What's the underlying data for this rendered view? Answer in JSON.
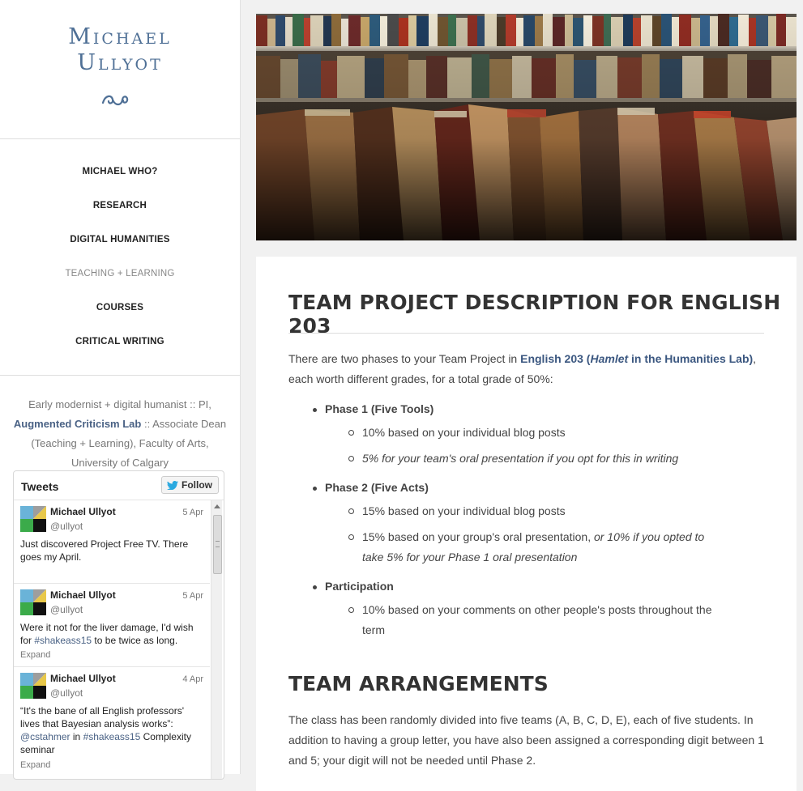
{
  "site": {
    "title_line1": "Michael",
    "title_line2": "Ullyot"
  },
  "nav": {
    "items": [
      "MICHAEL WHO?",
      "RESEARCH",
      "DIGITAL HUMANITIES",
      "TEACHING + LEARNING",
      "COURSES",
      "CRITICAL WRITING"
    ]
  },
  "bio": {
    "pre": "Early modernist + digital humanist :: PI,",
    "lab": "Augmented Criticism Lab",
    "post": ":: Associate Dean (Teaching + Learning), Faculty of Arts, University of Calgary"
  },
  "tweets": {
    "header": "Tweets",
    "follow_label": "Follow",
    "items": [
      {
        "name": "Michael Ullyot",
        "handle": "@ullyot",
        "date": "5 Apr",
        "text": "Just discovered Project Free TV. There goes my April."
      },
      {
        "name": "Michael Ullyot",
        "handle": "@ullyot",
        "date": "5 Apr",
        "text_pre": "Were it not for the liver damage, I'd wish for",
        "tag": "#shakeass15",
        "text_post": "to be twice as long.",
        "expand": "Expand"
      },
      {
        "name": "Michael Ullyot",
        "handle": "@ullyot",
        "date": "4 Apr",
        "text_pre": "“It's the bane of all English professors' lives that Bayesian analysis works”:",
        "mention": "@cstahmer",
        "text_in": "in",
        "tag": "#shakeass15",
        "text_post": "Complexity seminar",
        "expand": "Expand"
      }
    ]
  },
  "article": {
    "title": "TEAM PROJECT DESCRIPTION FOR ENGLISH 203",
    "intro_pre": "There are two phases to your Team Project in",
    "course_link_pre": "English 203 (",
    "course_link_em": "Hamlet",
    "course_link_post": " in the Humanities Lab)",
    "intro_post": ", each worth different grades, for a total grade of 50%:",
    "phases": [
      {
        "label": "Phase 1 (Five Tools)",
        "items": [
          "10% based on your individual blog posts",
          "5% for your team's oral presentation if you opt for this in writing"
        ]
      },
      {
        "label": "Phase 2 (Five Acts)",
        "items": [
          "15% based on your individual blog posts",
          "15% based on your group's oral presentation,",
          "or 10% if you opted to",
          "take 5% for your Phase 1 oral presentation"
        ]
      },
      {
        "label": "Participation",
        "items": [
          "10% based on your comments on other people's posts throughout the",
          "term"
        ]
      }
    ],
    "section2_title": "TEAM ARRANGEMENTS",
    "section2_lines": [
      "The class has been randomly divided into five teams (A, B, C, D, E), each of five students. In",
      "addition to having a group letter, you have also been assigned a corresponding digit between 1",
      "and 5; your digit will not be needed until Phase 2."
    ]
  },
  "colors": {
    "accent": "#4f7096",
    "link": "#3b5780"
  }
}
